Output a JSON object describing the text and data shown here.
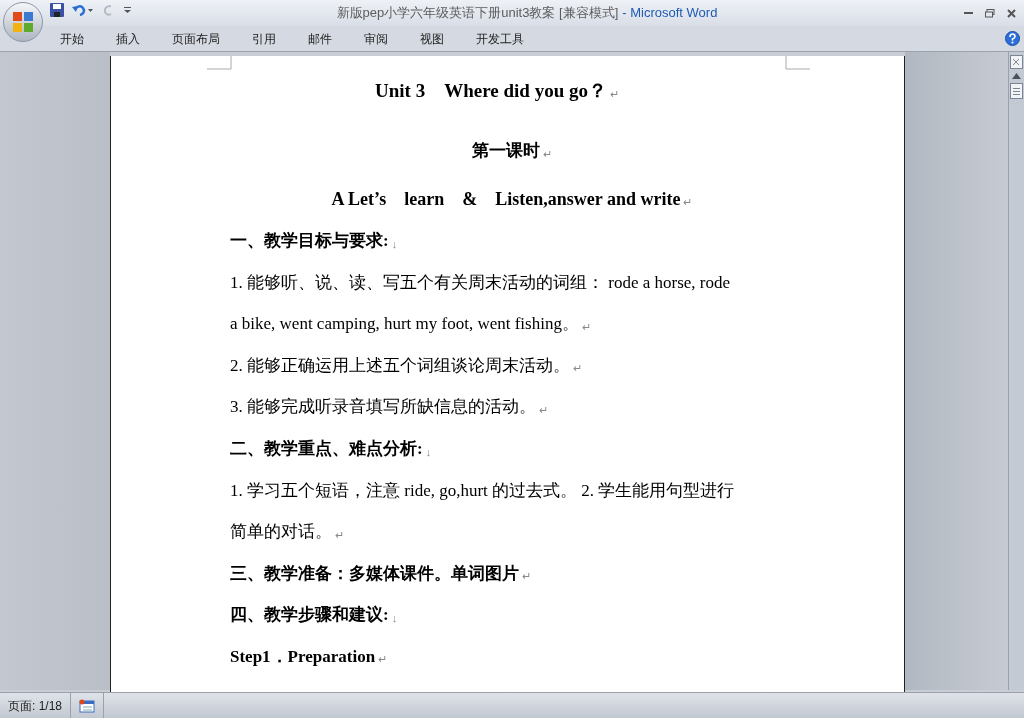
{
  "window": {
    "document_title": "新版pep小学六年级英语下册unit3教案 [兼容模式]",
    "app_title": "- Microsoft Word"
  },
  "ribbon_tabs": [
    {
      "label": "开始",
      "selected": false
    },
    {
      "label": "插入",
      "selected": false
    },
    {
      "label": "页面布局",
      "selected": false
    },
    {
      "label": "引用",
      "selected": false
    },
    {
      "label": "邮件",
      "selected": false
    },
    {
      "label": "审阅",
      "selected": false
    },
    {
      "label": "视图",
      "selected": false
    },
    {
      "label": "开发工具",
      "selected": false
    }
  ],
  "document": {
    "paragraphs": [
      {
        "kind": "title",
        "lines": [
          "Unit 3　Where did you go？"
        ],
        "mark": "↵"
      },
      {
        "kind": "subtitle",
        "lines": [
          "第一课时"
        ],
        "mark": "↵"
      },
      {
        "kind": "section",
        "lines": [
          "A Let’s　learn　&　Listen,answer and write"
        ],
        "mark": "↵"
      },
      {
        "kind": "heading",
        "lines": [
          "一、教学目标与要求:"
        ],
        "mark": "↓"
      },
      {
        "kind": "body",
        "lines": [
          "1. 能够听、说、读、写五个有关周末活动的词组：  rode a horse, rode",
          "a bike, went camping, hurt my foot, went fishing。"
        ],
        "mark": "↵"
      },
      {
        "kind": "body",
        "lines": [
          "2. 能够正确运用上述五个词组谈论周末活动。"
        ],
        "mark": "↵"
      },
      {
        "kind": "body",
        "lines": [
          "3. 能够完成听录音填写所缺信息的活动。"
        ],
        "mark": "↵"
      },
      {
        "kind": "heading",
        "lines": [
          "二、教学重点、难点分析:"
        ],
        "mark": "↓"
      },
      {
        "kind": "body",
        "lines": [
          "1. 学习五个短语，注意 ride, go,hurt 的过去式。 2. 学生能用句型进行",
          "简单的对话。"
        ],
        "mark": "↵"
      },
      {
        "kind": "heading",
        "lines": [
          "三、教学准备：多媒体课件。单词图片"
        ],
        "mark": "↵"
      },
      {
        "kind": "heading",
        "lines": [
          "四、教学步骤和建议:"
        ],
        "mark": "↓"
      },
      {
        "kind": "heading",
        "lines": [
          "Step1．Preparation"
        ],
        "mark": "↵"
      }
    ]
  },
  "status_bar": {
    "page": "页面: 1/18"
  }
}
